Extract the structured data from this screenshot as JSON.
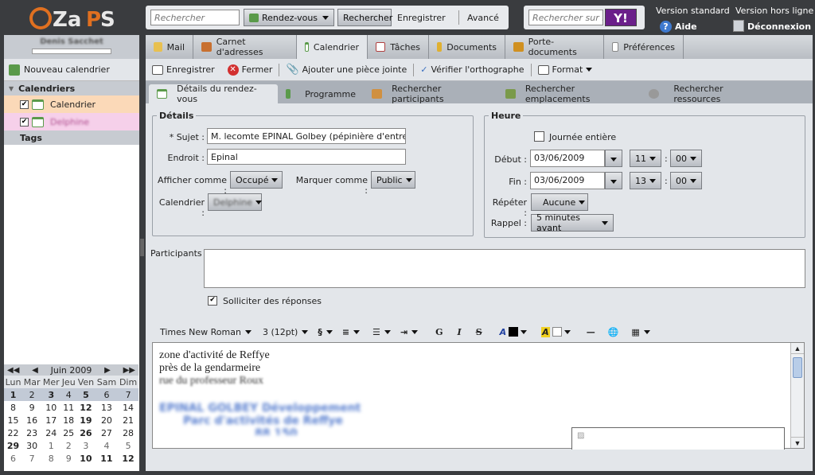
{
  "app": {
    "logo_text": "ZaPS"
  },
  "topbar": {
    "search_placeholder": "Rechercher",
    "search_type": "Rendez-vous",
    "search_button": "Rechercher",
    "save_search": "Enregistrer",
    "advanced": "Avancé",
    "web_search_placeholder": "Rechercher sur le Web",
    "yahoo": "Y!",
    "version_standard": "Version standard",
    "version_offline": "Version hors ligne",
    "help": "Aide",
    "logout": "Déconnexion"
  },
  "user": {
    "name": "Denis Sacchet"
  },
  "sidebar": {
    "new_calendar": "Nouveau calendrier",
    "calendars_header": "Calendriers",
    "calendars": [
      {
        "label": "Calendrier",
        "checked": true
      },
      {
        "label": "Delphine",
        "checked": true
      }
    ],
    "tags_header": "Tags"
  },
  "minical": {
    "month": "Juin 2009",
    "days": [
      "Lun",
      "Mar",
      "Mer",
      "Jeu",
      "Ven",
      "Sam",
      "Dim"
    ],
    "weeks": [
      [
        "1",
        "2",
        "3",
        "4",
        "5",
        "6",
        "7"
      ],
      [
        "8",
        "9",
        "10",
        "11",
        "12",
        "13",
        "14"
      ],
      [
        "15",
        "16",
        "17",
        "18",
        "19",
        "20",
        "21"
      ],
      [
        "22",
        "23",
        "24",
        "25",
        "26",
        "27",
        "28"
      ],
      [
        "29",
        "30",
        "1",
        "2",
        "3",
        "4",
        "5"
      ],
      [
        "6",
        "7",
        "8",
        "9",
        "10",
        "11",
        "12"
      ]
    ]
  },
  "tabs": [
    {
      "label": "Mail",
      "icon": "mail-icon",
      "color": "#e8c050"
    },
    {
      "label": "Carnet d'adresses",
      "icon": "contacts-icon",
      "color": "#c87030"
    },
    {
      "label": "Calendrier",
      "icon": "calendar-icon",
      "color": "#5a9a4a"
    },
    {
      "label": "Tâches",
      "icon": "tasks-icon",
      "color": "#b04040"
    },
    {
      "label": "Documents",
      "icon": "documents-icon",
      "color": "#e0b030"
    },
    {
      "label": "Porte-documents",
      "icon": "briefcase-icon",
      "color": "#d09020"
    },
    {
      "label": "Préférences",
      "icon": "preferences-icon",
      "color": "#888888"
    }
  ],
  "toolbar": {
    "save": "Enregistrer",
    "close": "Fermer",
    "attach": "Ajouter une pièce jointe",
    "spell": "Vérifier l'orthographe",
    "format": "Format"
  },
  "subtabs": [
    "Détails du rendez-vous",
    "Programme",
    "Rechercher participants",
    "Rechercher emplacements",
    "Rechercher ressources"
  ],
  "details": {
    "legend": "Détails",
    "subject_label": "* Sujet :",
    "subject_value": "M. lecomte EPINAL Golbey (pépinière d'entreprises)",
    "location_label": "Endroit :",
    "location_value": "Epinal",
    "show_as_label": "Afficher comme :",
    "show_as_value": "Occupé",
    "mark_as_label": "Marquer comme :",
    "mark_as_value": "Public",
    "calendar_label": "Calendrier :",
    "calendar_value": "Delphine"
  },
  "time": {
    "legend": "Heure",
    "all_day": "Journée entière",
    "start_label": "Début :",
    "start_date": "03/06/2009",
    "start_hour": "11",
    "start_min": "00",
    "end_label": "Fin :",
    "end_date": "03/06/2009",
    "end_hour": "13",
    "end_min": "00",
    "colon": ":",
    "repeat_label": "Répéter :",
    "repeat_value": "Aucune",
    "reminder_label": "Rappel :",
    "reminder_value": "5 minutes avant"
  },
  "participants": {
    "label": "Participants :",
    "request_responses": "Solliciter des réponses"
  },
  "format_bar": {
    "font": "Times New Roman",
    "size": "3 (12pt)",
    "para": "§",
    "bold": "G",
    "italic": "I",
    "strike": "S"
  },
  "editor": {
    "lines": [
      "zone d'activité de Reffye",
      "près de la gendarmeire",
      "rue du professeur Roux"
    ],
    "blurred1": "EPINAL GOLBEY Développement",
    "blurred2": "Parc d'activités de Reffye",
    "blurred3": "88 150"
  }
}
